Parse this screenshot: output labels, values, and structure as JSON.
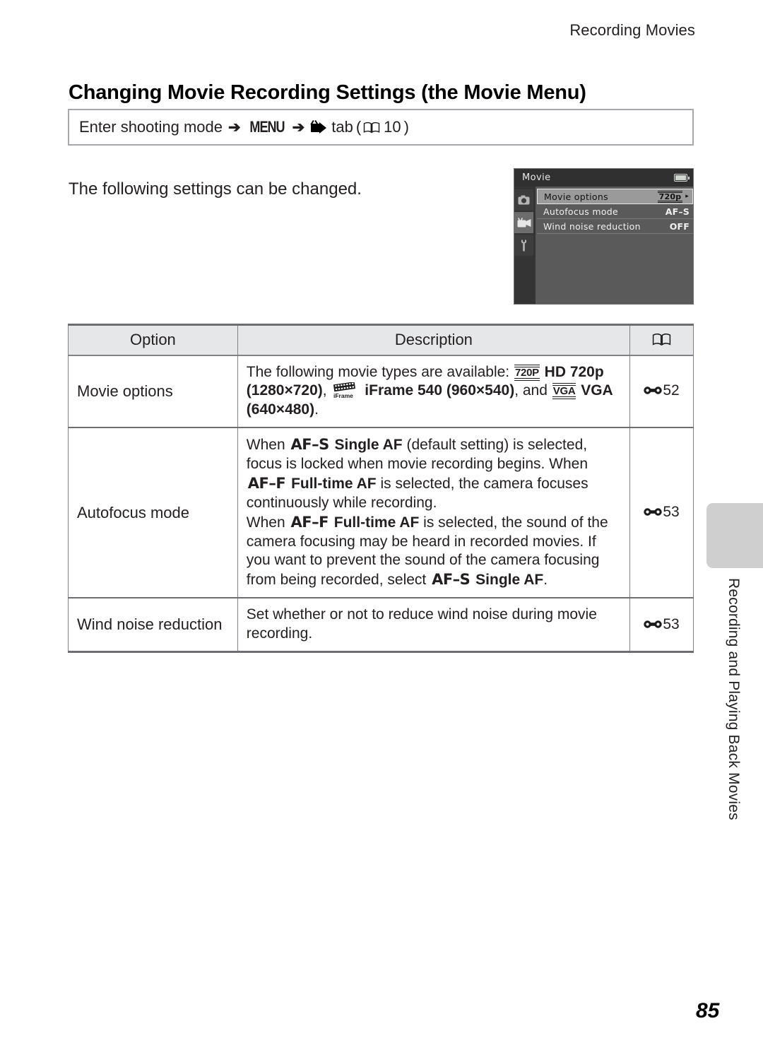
{
  "running_head": "Recording Movies",
  "section_title": "Changing Movie Recording Settings (the Movie Menu)",
  "nav_box": {
    "lead": "Enter shooting mode",
    "arrow": "➔",
    "menu_label": "MENU",
    "movie_tab_icon": "movie-camera-icon",
    "tab_word": "tab",
    "open_paren": "(",
    "book_icon": "open-book-icon",
    "page_ref": "10",
    "close_paren": ")"
  },
  "intro_text": "The following settings can be changed.",
  "camera_screen": {
    "title": "Movie",
    "battery_icon": "battery-icon",
    "tabs": [
      {
        "icon": "camera-icon",
        "selected": false
      },
      {
        "icon": "movie-camera-icon",
        "selected": true
      },
      {
        "icon": "wrench-icon",
        "selected": false
      }
    ],
    "rows": [
      {
        "label": "Movie options",
        "value": "720p",
        "badge": true,
        "caret": "▸",
        "highlighted": true
      },
      {
        "label": "Autofocus mode",
        "value": "AF–S",
        "badge": false,
        "caret": "",
        "highlighted": false
      },
      {
        "label": "Wind noise reduction",
        "value": "OFF",
        "badge": false,
        "caret": "",
        "highlighted": false
      }
    ]
  },
  "table": {
    "headers": {
      "option": "Option",
      "description": "Description",
      "reference": "open-book-icon"
    },
    "rows": [
      {
        "option": "Movie options",
        "ref": "52",
        "desc_parts": [
          {
            "t": "text",
            "v": "The following movie types are available: "
          },
          {
            "t": "film-badge",
            "v": "720P"
          },
          {
            "t": "bold",
            "v": " HD 720p (1280×720)"
          },
          {
            "t": "text",
            "v": ", "
          },
          {
            "t": "iframe-badge",
            "v": "iFrame"
          },
          {
            "t": "bold",
            "v": " iFrame 540 (960×540)"
          },
          {
            "t": "text",
            "v": ", and "
          },
          {
            "t": "film-badge",
            "v": "VGA"
          },
          {
            "t": "bold",
            "v": " VGA (640×480)"
          },
          {
            "t": "text",
            "v": "."
          }
        ]
      },
      {
        "option": "Autofocus mode",
        "ref": "53",
        "desc_parts": [
          {
            "t": "text",
            "v": "When "
          },
          {
            "t": "af-glyph",
            "v": "AF–S"
          },
          {
            "t": "bold",
            "v": " Single AF"
          },
          {
            "t": "text",
            "v": " (default setting) is selected, focus is locked when movie recording begins. When "
          },
          {
            "t": "af-glyph",
            "v": "AF–F"
          },
          {
            "t": "bold",
            "v": " Full-time AF"
          },
          {
            "t": "text",
            "v": " is selected, the camera focuses continuously while recording."
          },
          {
            "t": "br",
            "v": ""
          },
          {
            "t": "text",
            "v": "When "
          },
          {
            "t": "af-glyph",
            "v": "AF–F"
          },
          {
            "t": "bold",
            "v": " Full-time AF"
          },
          {
            "t": "text",
            "v": " is selected, the sound of the camera focusing may be heard in recorded movies. If you want to prevent the sound of the camera focusing from being recorded, select "
          },
          {
            "t": "af-glyph",
            "v": "AF–S"
          },
          {
            "t": "bold",
            "v": " Single AF"
          },
          {
            "t": "text",
            "v": "."
          }
        ]
      },
      {
        "option": "Wind noise reduction",
        "ref": "53",
        "desc_parts": [
          {
            "t": "text",
            "v": "Set whether or not to reduce wind noise during movie recording."
          }
        ]
      }
    ]
  },
  "chapter_tab": "Recording and Playing Back Movies",
  "page_number": "85"
}
